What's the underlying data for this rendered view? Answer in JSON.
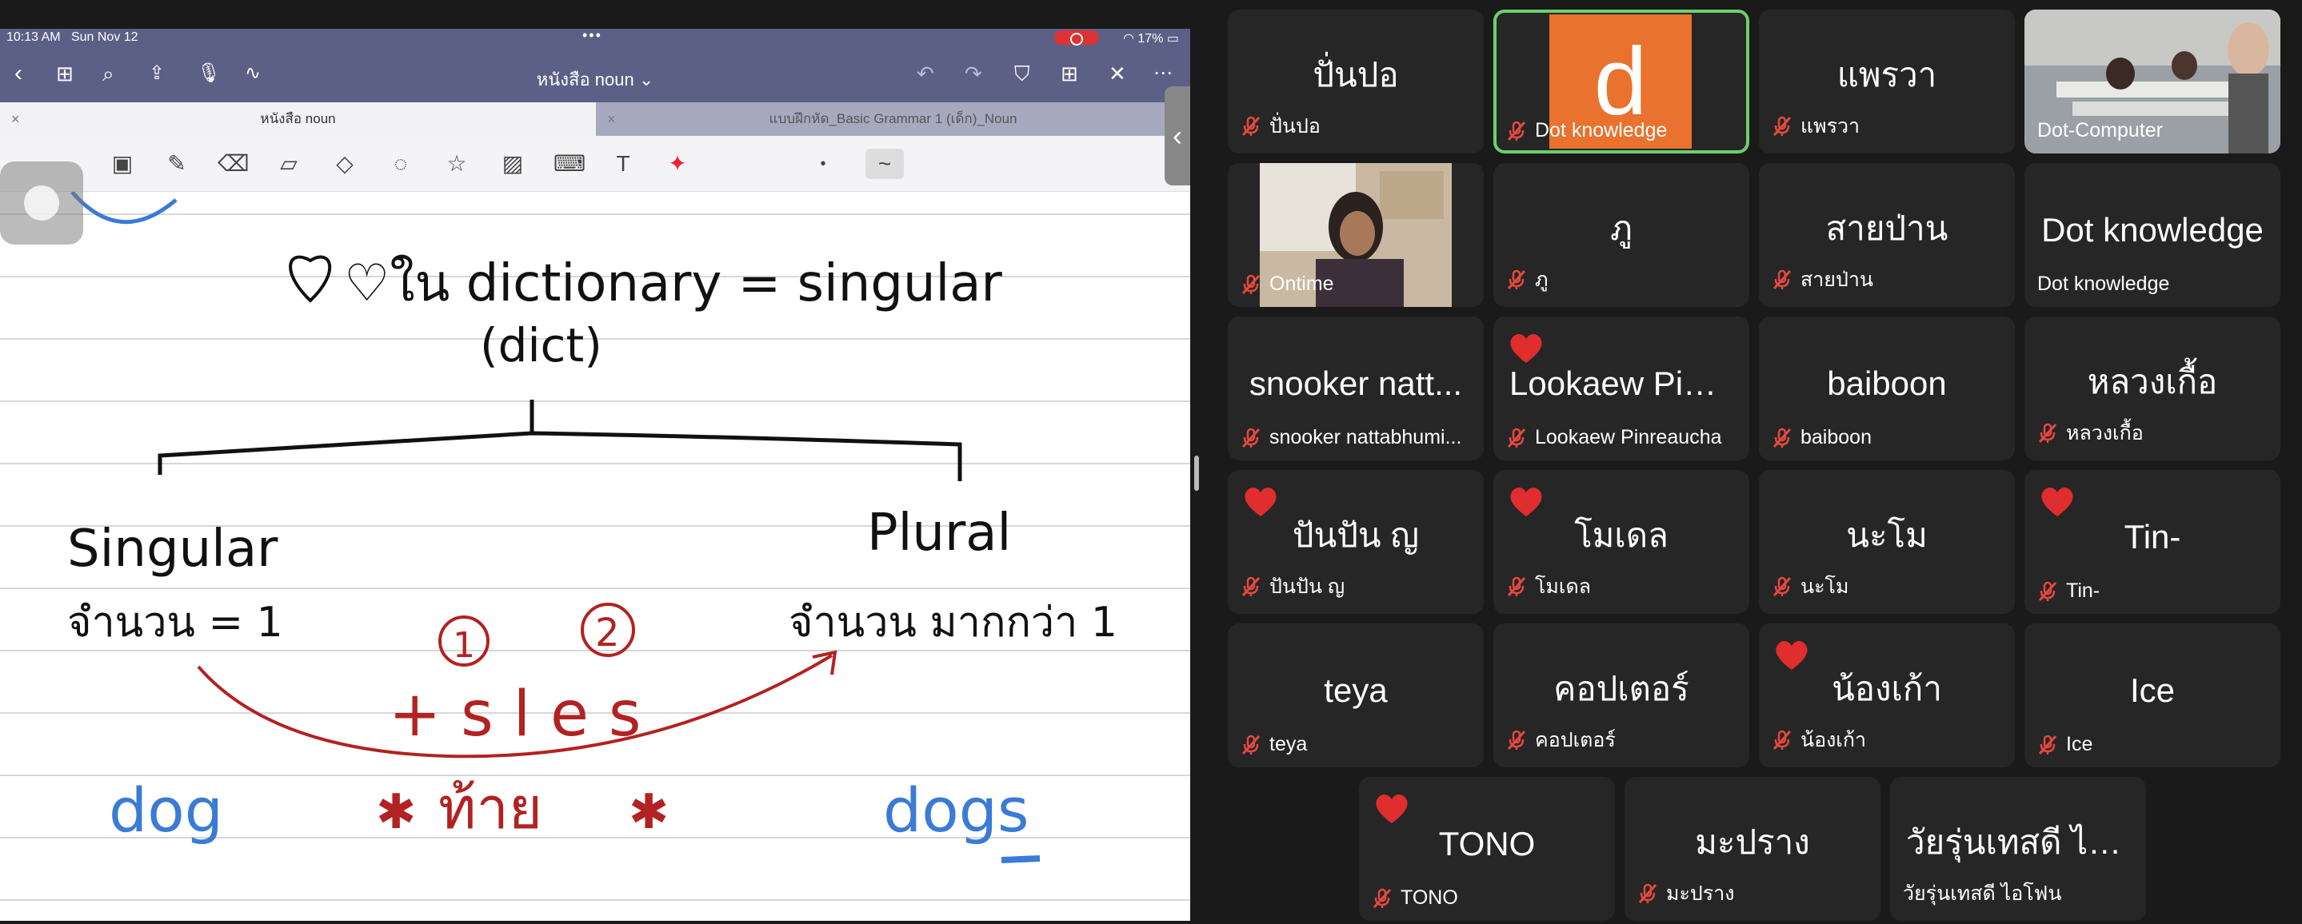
{
  "ipad": {
    "status_time": "10:13 AM",
    "status_date": "Sun Nov 12",
    "battery": "17%",
    "doc_title": "หนังสือ noun ⌄",
    "tabs": [
      {
        "label": "หนังสือ noun"
      },
      {
        "label": "แบบฝึกหัด_Basic Grammar 1 (เด็ก)_Noun"
      }
    ]
  },
  "note": {
    "line1": "♡ใน dictionary = singular",
    "line2": "(dict)",
    "singular": "Singular",
    "plural": "Plural",
    "count_one": "จำนวน = 1",
    "count_more": "จำนวน มากกว่า  1",
    "circle1": "1",
    "circle2": "2",
    "suffix": "+ s l e s",
    "star_label": "ท้าย",
    "example_singular": "dog",
    "example_plural": "dogs"
  },
  "colors": {
    "accent_active": "#6cd16c",
    "avatar_orange": "#e8722e",
    "ink_red": "#b22222",
    "ink_blue": "#3a7bd5",
    "heart": "#e02d2d"
  },
  "participants": [
    {
      "display": "ปั่นปอ",
      "name": "ปั่นปอ",
      "heart": false,
      "muted": true,
      "type": "name"
    },
    {
      "display": "d",
      "name": "Dot knowledge",
      "heart": false,
      "muted": true,
      "type": "avatar",
      "active": true
    },
    {
      "display": "แพรวา",
      "name": "แพรวา",
      "heart": false,
      "muted": true,
      "type": "name"
    },
    {
      "display": "",
      "name": "Dot-Computer",
      "heart": false,
      "muted": false,
      "type": "video"
    },
    {
      "display": "",
      "name": "Ontime",
      "heart": false,
      "muted": true,
      "type": "video"
    },
    {
      "display": "ภู",
      "name": "ภู",
      "heart": false,
      "muted": true,
      "type": "name"
    },
    {
      "display": "สายป่าน",
      "name": "สายป่าน",
      "heart": false,
      "muted": true,
      "type": "name"
    },
    {
      "display": "Dot knowledge",
      "name": "Dot knowledge",
      "heart": false,
      "muted": false,
      "type": "name"
    },
    {
      "display": "snooker   natt...",
      "name": "snooker   nattabhumi...",
      "heart": false,
      "muted": true,
      "type": "name"
    },
    {
      "display": "Lookaew Pinr...",
      "name": "Lookaew Pinreaucha",
      "heart": true,
      "muted": true,
      "type": "name"
    },
    {
      "display": "baiboon",
      "name": "baiboon",
      "heart": false,
      "muted": true,
      "type": "name"
    },
    {
      "display": "หลวงเกื้อ",
      "name": "หลวงเกื้อ",
      "heart": false,
      "muted": true,
      "type": "name"
    },
    {
      "display": "ปันปัน  ญ",
      "name": "ปันปัน  ญ",
      "heart": true,
      "muted": true,
      "type": "name"
    },
    {
      "display": "โมเดล",
      "name": "โมเดล",
      "heart": true,
      "muted": true,
      "type": "name"
    },
    {
      "display": "นะโม",
      "name": "นะโม",
      "heart": false,
      "muted": true,
      "type": "name"
    },
    {
      "display": "Tin-",
      "name": "Tin-",
      "heart": true,
      "muted": true,
      "type": "name"
    },
    {
      "display": "teya",
      "name": "teya",
      "heart": false,
      "muted": true,
      "type": "name"
    },
    {
      "display": "คอปเตอร์",
      "name": "คอปเตอร์",
      "heart": false,
      "muted": true,
      "type": "name"
    },
    {
      "display": "น้องเก้า",
      "name": "น้องเก้า",
      "heart": true,
      "muted": true,
      "type": "name"
    },
    {
      "display": "Ice",
      "name": "Ice",
      "heart": false,
      "muted": true,
      "type": "name"
    },
    {
      "display": "TONO",
      "name": "TONO",
      "heart": true,
      "muted": true,
      "type": "name"
    },
    {
      "display": "มะปราง",
      "name": "มะปราง",
      "heart": false,
      "muted": true,
      "type": "name"
    },
    {
      "display": "วัยรุ่นเทสดี  ไอ...",
      "name": "วัยรุ่นเทสดี  ไอโฟน",
      "heart": false,
      "muted": false,
      "type": "name"
    }
  ]
}
